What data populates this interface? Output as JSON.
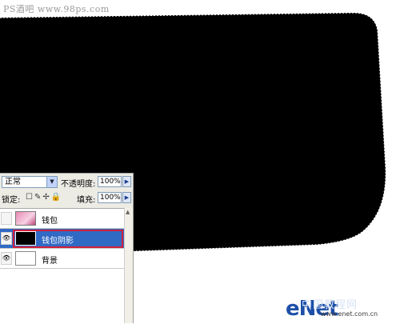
{
  "watermark_top": "PS酒吧 www.98ps.com",
  "layers_panel": {
    "blend_mode": "正常",
    "opacity_label": "不透明度:",
    "opacity_value": "100%",
    "lock_label": "锁定:",
    "lock_icons": "☐✎✢🔒",
    "fill_label": "填充:",
    "fill_value": "100%",
    "layers": [
      {
        "name": "钱包",
        "visible": false,
        "selected": false
      },
      {
        "name": "钱包阴影",
        "visible": true,
        "selected": true
      },
      {
        "name": "背景",
        "visible": true,
        "selected": false
      }
    ]
  },
  "watermark_bottom": {
    "brand": "eNet",
    "cn_text": "中国教程网",
    "url": "www.enet.com.cn"
  },
  "colors": {
    "shadow_shape": "#000000",
    "selection_highlight": "#316ac5",
    "selection_outline": "#d0203a",
    "watermark_blue": "#1d4fa8"
  }
}
